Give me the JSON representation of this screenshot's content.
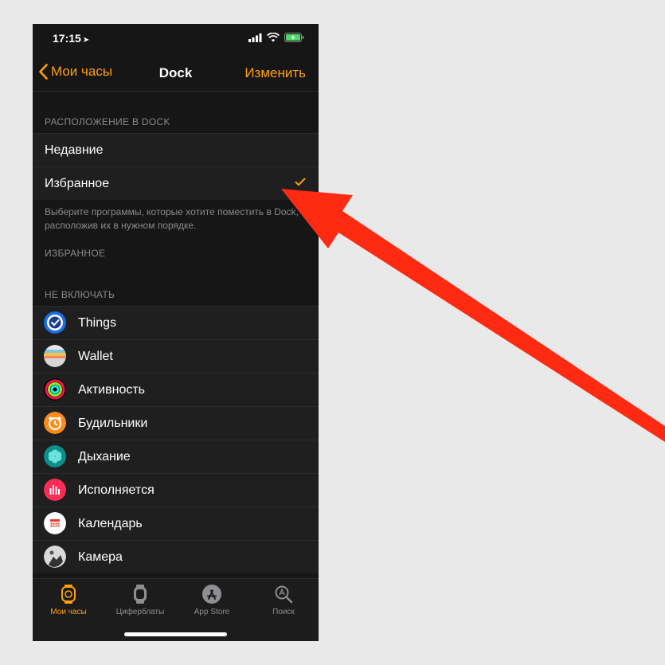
{
  "status_bar": {
    "time": "17:15",
    "location_glyph": "➤"
  },
  "nav": {
    "back_label": "Мои часы",
    "title": "Dock",
    "action_label": "Изменить"
  },
  "dock_section": {
    "header": "РАСПОЛОЖЕНИЕ В DOCK",
    "options": [
      {
        "label": "Недавние",
        "selected": false
      },
      {
        "label": "Избранное",
        "selected": true
      }
    ],
    "note": "Выберите программы, которые хотите поместить в Dock, расположив их в нужном порядке."
  },
  "favorites_header": "ИЗБРАННОЕ",
  "exclude_section": {
    "header": "НЕ ВКЛЮЧАТЬ",
    "apps": [
      {
        "label": "Things",
        "icon": "things-icon"
      },
      {
        "label": "Wallet",
        "icon": "wallet-icon"
      },
      {
        "label": "Активность",
        "icon": "activity-icon"
      },
      {
        "label": "Будильники",
        "icon": "alarm-icon"
      },
      {
        "label": "Дыхание",
        "icon": "breathe-icon"
      },
      {
        "label": "Исполняется",
        "icon": "now-playing-icon"
      },
      {
        "label": "Календарь",
        "icon": "calendar-icon"
      },
      {
        "label": "Камера",
        "icon": "camera-remote-icon"
      }
    ]
  },
  "tabbar": {
    "tabs": [
      {
        "label": "Мои часы",
        "active": true,
        "icon": "watch-icon"
      },
      {
        "label": "Циферблаты",
        "active": false,
        "icon": "watch-face-icon"
      },
      {
        "label": "App Store",
        "active": false,
        "icon": "app-store-icon"
      },
      {
        "label": "Поиск",
        "active": false,
        "icon": "search-icon"
      }
    ]
  },
  "colors": {
    "accent": "#ff9f0a",
    "arrow": "#ff2a12",
    "background": "#161616"
  }
}
